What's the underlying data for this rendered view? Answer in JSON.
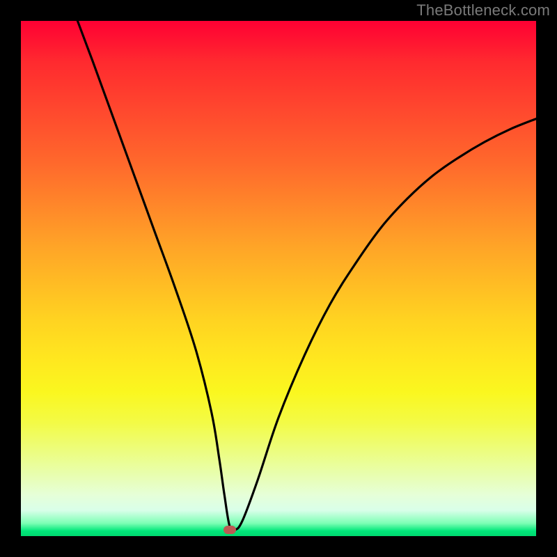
{
  "watermark": "TheBottleneck.com",
  "chart_data": {
    "type": "line",
    "title": "",
    "xlabel": "",
    "ylabel": "",
    "xlim": [
      0,
      100
    ],
    "ylim": [
      0,
      100
    ],
    "grid": false,
    "legend": false,
    "marker": {
      "x": 40.5,
      "y": 1.2,
      "color": "#bb5b54"
    },
    "series": [
      {
        "name": "curve",
        "color": "#000000",
        "x": [
          11,
          14,
          18,
          22,
          26,
          30,
          34,
          37,
          38.5,
          39.5,
          40.5,
          41.5,
          43,
          46,
          50,
          55,
          60,
          65,
          70,
          75,
          80,
          85,
          90,
          95,
          100
        ],
        "y": [
          100,
          92,
          81,
          70,
          59,
          48,
          36,
          24,
          15,
          8,
          2,
          1.2,
          3,
          11,
          23,
          35,
          45,
          53,
          60,
          65.5,
          70,
          73.5,
          76.5,
          79,
          81
        ]
      }
    ],
    "background_gradient": {
      "top": "#ff0033",
      "mid": "#ffe81f",
      "bottom": "#00d86f"
    }
  }
}
